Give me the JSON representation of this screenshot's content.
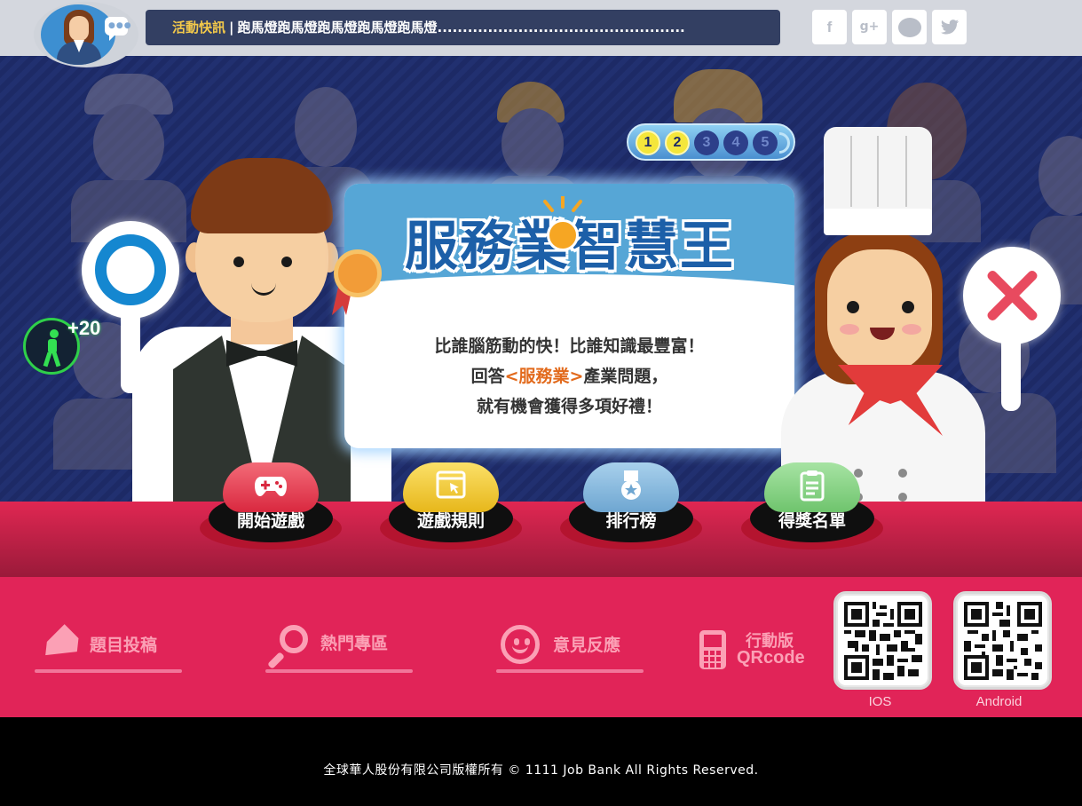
{
  "topbar": {
    "ticker_tag": "活動快訊",
    "ticker_text": "跑馬燈跑馬燈跑馬燈跑馬燈跑馬燈.................................................",
    "social": {
      "facebook": "f",
      "google_plus": "g+",
      "twitter": "🐦"
    }
  },
  "hero": {
    "progress": [
      "1",
      "2",
      "3",
      "4",
      "5"
    ],
    "progress_current": 2,
    "title": "服務業智慧王",
    "slogan_line1": "比誰腦筋動的快！比誰知識最豐富！",
    "slogan_line2_pre": "回答",
    "slogan_line2_hl": "<服務業>",
    "slogan_line2_post": "產業問題，",
    "slogan_line3": "就有機會獲得多項好禮！",
    "bonus": "+20"
  },
  "buttons": {
    "start": "開始遊戲",
    "rules": "遊戲規則",
    "ranking": "排行榜",
    "winners": "得獎名單"
  },
  "footer_links": {
    "submit": "題目投稿",
    "hot": "熱門專區",
    "feedback": "意見反應",
    "mobile_line1": "行動版",
    "mobile_line2": "QRcode",
    "ios": "IOS",
    "android": "Android"
  },
  "copyright": "全球華人股份有限公司版權所有 ©  1111 Job Bank All Rights Reserved.",
  "colors": {
    "topbar_bg": "#d4d7de",
    "ticker_bg": "#333f62",
    "hero_bg": "#1d2a66",
    "title_blue": "#1c5fa8",
    "pink": "#e12458",
    "link_pink": "#fba0b5"
  }
}
